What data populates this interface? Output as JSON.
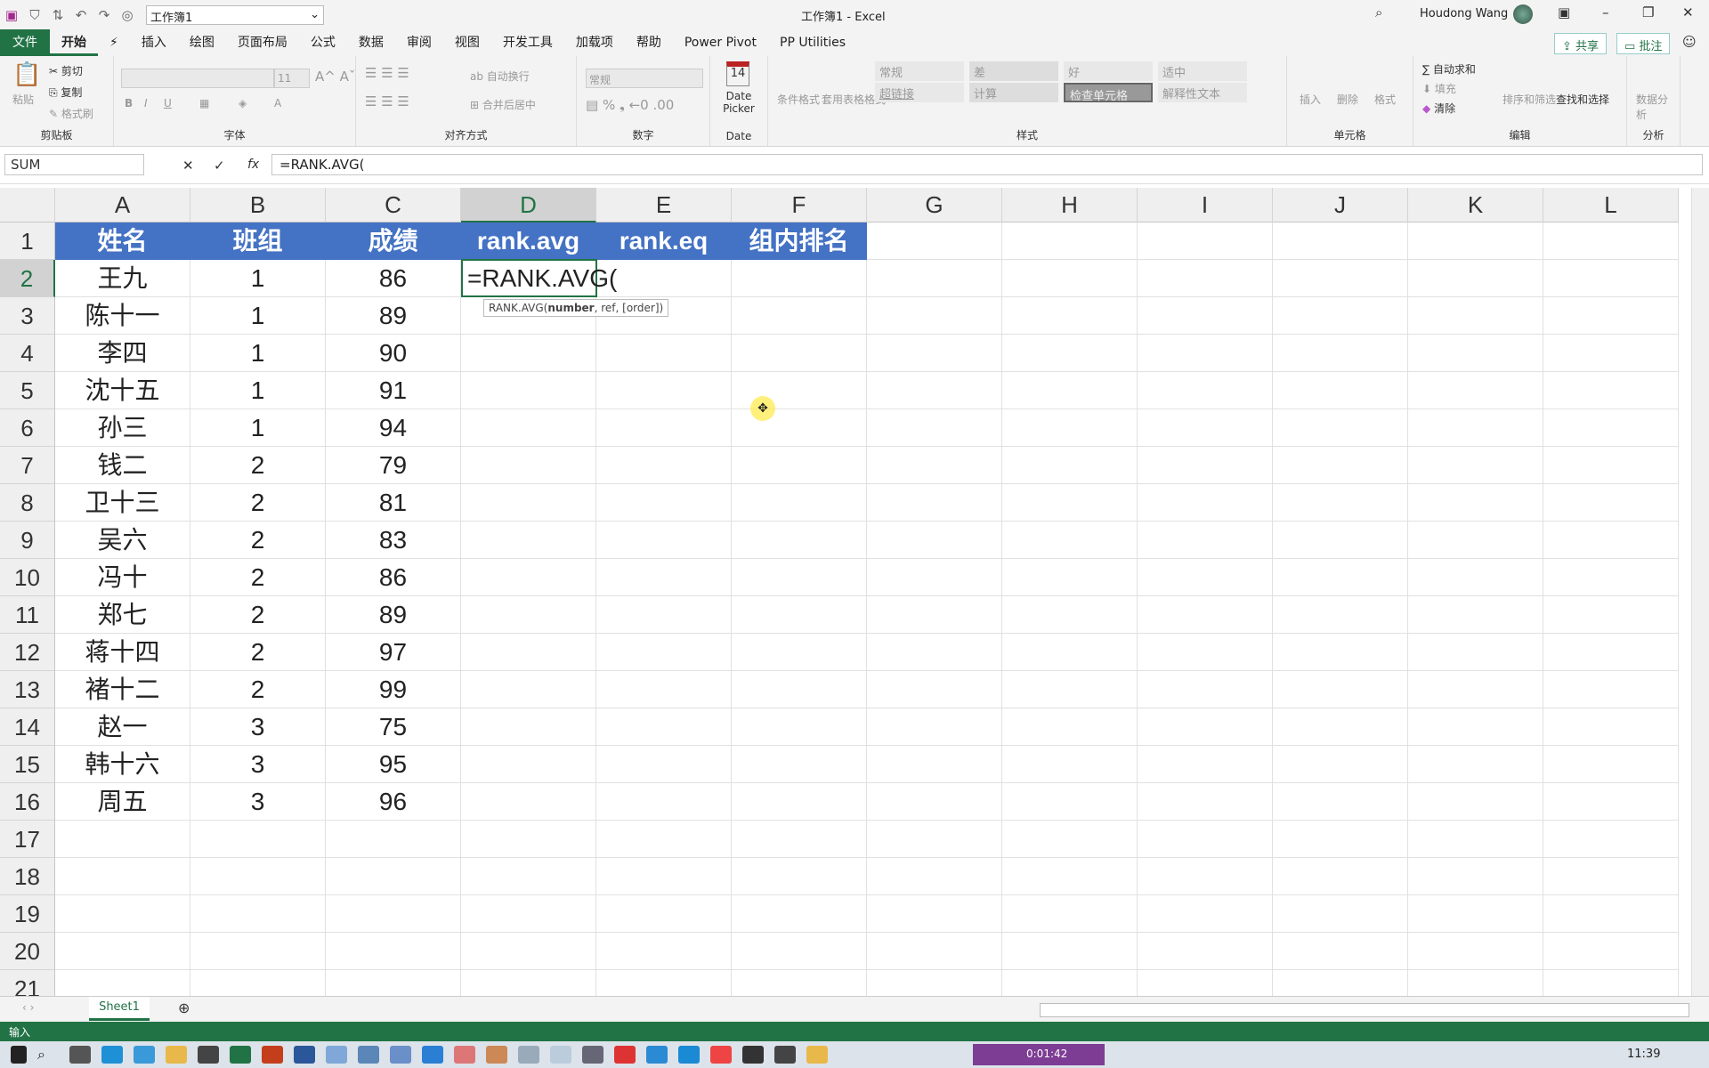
{
  "titlebar": {
    "workbook_select": "工作簿1",
    "title": "工作簿1  -  Excel",
    "user": "Houdong Wang"
  },
  "tabs": [
    "文件",
    "开始",
    "⚡",
    "插入",
    "绘图",
    "页面布局",
    "公式",
    "数据",
    "审阅",
    "视图",
    "开发工具",
    "加载项",
    "帮助",
    "Power Pivot",
    "PP Utilities"
  ],
  "active_tab": "开始",
  "share_label": "共享",
  "comment_label": "批注",
  "ribbon": {
    "clipboard": {
      "label": "剪贴板",
      "paste": "粘贴",
      "cut": "剪切",
      "copy": "复制",
      "format_painter": "格式刷"
    },
    "font": {
      "label": "字体",
      "size": "11",
      "bold": "B",
      "italic": "I",
      "underline": "U"
    },
    "alignment": {
      "label": "对齐方式",
      "wrap": "自动换行",
      "merge": "合并后居中"
    },
    "number": {
      "label": "数字",
      "format": "常规"
    },
    "date": {
      "label": "Date",
      "button": "Date Picker",
      "day": "14"
    },
    "styles": {
      "label": "样式",
      "cond": "条件格式",
      "table": "套用表格格式",
      "cells": [
        "常规",
        "差",
        "好",
        "适中",
        "超链接",
        "计算",
        "检查单元格",
        "解释性文本"
      ]
    },
    "cells": {
      "label": "单元格",
      "insert": "插入",
      "delete": "删除",
      "format": "格式"
    },
    "editing": {
      "label": "编辑",
      "autosum": "自动求和",
      "fill": "填充",
      "clear": "清除",
      "sort": "排序和筛选",
      "find": "查找和选择"
    },
    "analysis": {
      "label": "分析",
      "data": "数据分析"
    }
  },
  "formula_bar": {
    "name_box": "SUM",
    "formula": "=RANK.AVG("
  },
  "columns": [
    "A",
    "B",
    "C",
    "D",
    "E",
    "F",
    "G",
    "H",
    "I",
    "J",
    "K",
    "L"
  ],
  "selected_column": "D",
  "selected_row": 2,
  "headers": [
    "姓名",
    "班组",
    "成绩",
    "rank.avg",
    "rank.eq",
    "组内排名"
  ],
  "rows": [
    [
      "王九",
      "1",
      "86"
    ],
    [
      "陈十一",
      "1",
      "89"
    ],
    [
      "李四",
      "1",
      "90"
    ],
    [
      "沈十五",
      "1",
      "91"
    ],
    [
      "孙三",
      "1",
      "94"
    ],
    [
      "钱二",
      "2",
      "79"
    ],
    [
      "卫十三",
      "2",
      "81"
    ],
    [
      "吴六",
      "2",
      "83"
    ],
    [
      "冯十",
      "2",
      "86"
    ],
    [
      "郑七",
      "2",
      "89"
    ],
    [
      "蒋十四",
      "2",
      "97"
    ],
    [
      "褚十二",
      "2",
      "99"
    ],
    [
      "赵一",
      "3",
      "75"
    ],
    [
      "韩十六",
      "3",
      "95"
    ],
    [
      "周五",
      "3",
      "96"
    ]
  ],
  "edit_cell": "=RANK.AVG(",
  "tooltip": {
    "func": "RANK.AVG(",
    "arg1": "number",
    "rest": ", ref, [order])"
  },
  "sheet_tab": "Sheet1",
  "status": {
    "mode": "输入"
  },
  "taskbar": {
    "recorder_time": "0:01:42",
    "clock": "11:39"
  },
  "colors": {
    "excel_green": "#217346",
    "header_blue": "#4472c4"
  }
}
